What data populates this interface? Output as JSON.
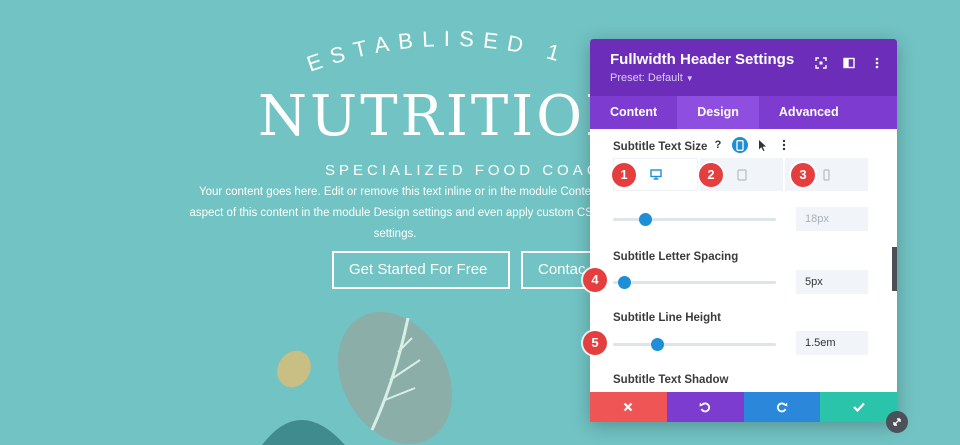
{
  "hero": {
    "established": "ESTABLISED 1",
    "title": "NUTRITION",
    "subtitle": "SPECIALIZED FOOD COAC",
    "body_line1": "Your content goes here. Edit or remove this text inline or in the module Conte",
    "body_line2": "aspect of this content in the module Design settings and even apply custom CSS",
    "body_line3": "settings.",
    "btn_primary": "Get Started For Free",
    "btn_secondary": "Contac"
  },
  "panel": {
    "title": "Fullwidth Header Settings",
    "preset": "Preset: Default",
    "header_icons": [
      "focus-icon",
      "sidebar-icon",
      "more-icon"
    ],
    "tabs": [
      {
        "label": "Content",
        "active": false
      },
      {
        "label": "Design",
        "active": true
      },
      {
        "label": "Advanced",
        "active": false
      }
    ],
    "subtitle_text_size": {
      "label": "Subtitle Text Size",
      "help": "?",
      "value": "18px",
      "slider_fraction": 0.2
    },
    "letter_spacing": {
      "label": "Subtitle Letter Spacing",
      "value": "5px",
      "slider_fraction": 0.07
    },
    "line_height": {
      "label": "Subtitle Line Height",
      "value": "1.5em",
      "slider_fraction": 0.27
    },
    "text_shadow": {
      "label": "Subtitle Text Shadow"
    },
    "device_tabs": [
      "desktop-icon",
      "tablet-icon",
      "phone-icon"
    ]
  },
  "badges": [
    "1",
    "2",
    "3",
    "4",
    "5"
  ],
  "colors": {
    "background": "#72c3c4",
    "panel_header": "#6c2eb9",
    "tabs_bar": "#7d3bcf",
    "accent_blue": "#1e8fd6",
    "badge_red": "#e53e3e",
    "cancel": "#ef5555",
    "undo": "#7c3cd0",
    "redo": "#2b87da",
    "save": "#29c4a9"
  }
}
